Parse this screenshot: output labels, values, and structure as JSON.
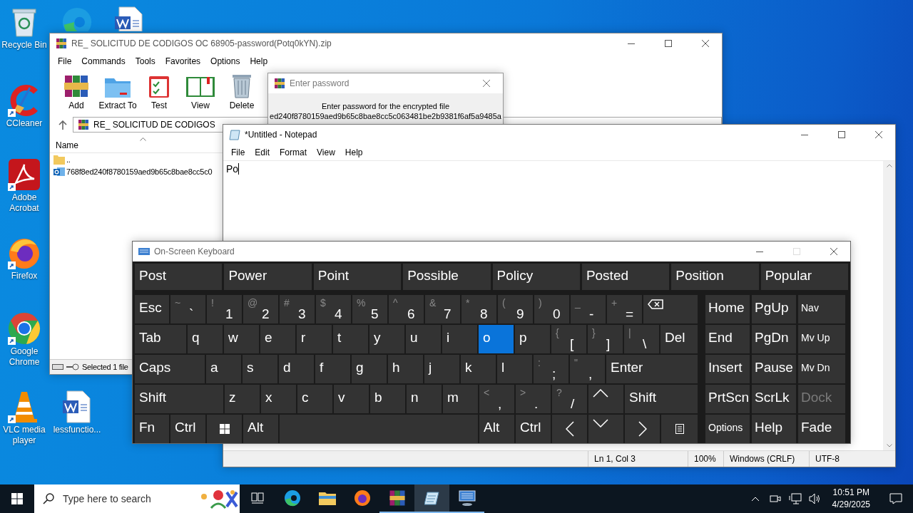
{
  "desktop_icons": [
    {
      "label": "Recycle Bin"
    },
    {
      "label": "CCleaner"
    },
    {
      "label": "Adobe Acrobat"
    },
    {
      "label": "Firefox"
    },
    {
      "label": "Google Chrome"
    },
    {
      "label": "VLC media player"
    },
    {
      "label": "lessfunctio..."
    }
  ],
  "winrar": {
    "title": "RE_ SOLICITUD DE CODIGOS OC 68905-password(Potq0kYN).zip",
    "menu": [
      "File",
      "Commands",
      "Tools",
      "Favorites",
      "Options",
      "Help"
    ],
    "toolbar": [
      "Add",
      "Extract To",
      "Test",
      "View",
      "Delete"
    ],
    "path": "RE_ SOLICITUD DE CODIGOS",
    "columns": [
      "Name"
    ],
    "files": [
      {
        "name": "..",
        "kind": "folder"
      },
      {
        "name": "768f8ed240f8780159aed9b65c8bae8cc5c0",
        "kind": "mail"
      }
    ],
    "status": "Selected 1 file"
  },
  "password_dialog": {
    "title": "Enter password",
    "message": "Enter password for the encrypted file",
    "file_name": "ed240f8780159aed9b65c8bae8cc5c063481be2b9381f6af5a9485a"
  },
  "notepad": {
    "title": "*Untitled - Notepad",
    "menu": [
      "File",
      "Edit",
      "Format",
      "View",
      "Help"
    ],
    "text": "Po",
    "status": [
      "Ln 1, Col 3",
      "100%",
      "Windows (CRLF)",
      "UTF-8"
    ]
  },
  "osk": {
    "title": "On-Screen Keyboard",
    "predictions": [
      "Post",
      "Power",
      "Point",
      "Possible",
      "Policy",
      "Posted",
      "Position",
      "Popular"
    ],
    "rows": [
      {
        "keys": [
          {
            "label": "Esc",
            "kind": "text",
            "selected": false
          },
          {
            "label": "`",
            "shift": "~",
            "kind": "text",
            "selected": false
          },
          {
            "label": "1",
            "shift": "!",
            "kind": "text",
            "selected": false
          },
          {
            "label": "2",
            "shift": "@",
            "kind": "text",
            "selected": false
          },
          {
            "label": "3",
            "shift": "#",
            "kind": "text",
            "selected": false
          },
          {
            "label": "4",
            "shift": "$",
            "kind": "text",
            "selected": false
          },
          {
            "label": "5",
            "shift": "%",
            "kind": "text",
            "selected": false
          },
          {
            "label": "6",
            "shift": "^",
            "kind": "text",
            "selected": false
          },
          {
            "label": "7",
            "shift": "&",
            "kind": "text",
            "selected": false
          },
          {
            "label": "8",
            "shift": "*",
            "kind": "text",
            "selected": false
          },
          {
            "label": "9",
            "shift": "(",
            "kind": "text",
            "selected": false
          },
          {
            "label": "0",
            "shift": ")",
            "kind": "text",
            "selected": false
          },
          {
            "label": "-",
            "shift": "_",
            "kind": "text",
            "selected": false
          },
          {
            "label": "=",
            "shift": "+",
            "kind": "text",
            "selected": false
          },
          {
            "kind": "backspace",
            "selected": false
          }
        ]
      },
      {
        "keys": [
          {
            "label": "Tab",
            "kind": "text",
            "selected": false
          },
          {
            "label": "q",
            "kind": "text",
            "selected": false
          },
          {
            "label": "w",
            "kind": "text",
            "selected": false
          },
          {
            "label": "e",
            "kind": "text",
            "selected": false
          },
          {
            "label": "r",
            "kind": "text",
            "selected": false
          },
          {
            "label": "t",
            "kind": "text",
            "selected": false
          },
          {
            "label": "y",
            "kind": "text",
            "selected": false
          },
          {
            "label": "u",
            "kind": "text",
            "selected": false
          },
          {
            "label": "i",
            "kind": "text",
            "selected": false
          },
          {
            "label": "o",
            "kind": "text",
            "selected": true
          },
          {
            "label": "p",
            "kind": "text",
            "selected": false
          },
          {
            "label": "[",
            "shift": "{",
            "kind": "text",
            "selected": false
          },
          {
            "label": "]",
            "shift": "}",
            "kind": "text",
            "selected": false
          },
          {
            "label": "\\",
            "shift": "|",
            "kind": "text",
            "selected": false
          },
          {
            "label": "Del",
            "kind": "text",
            "selected": false
          }
        ]
      },
      {
        "keys": [
          {
            "label": "Caps",
            "kind": "text",
            "selected": false
          },
          {
            "label": "a",
            "kind": "text",
            "selected": false
          },
          {
            "label": "s",
            "kind": "text",
            "selected": false
          },
          {
            "label": "d",
            "kind": "text",
            "selected": false
          },
          {
            "label": "f",
            "kind": "text",
            "selected": false
          },
          {
            "label": "g",
            "kind": "text",
            "selected": false
          },
          {
            "label": "h",
            "kind": "text",
            "selected": false
          },
          {
            "label": "j",
            "kind": "text",
            "selected": false
          },
          {
            "label": "k",
            "kind": "text",
            "selected": false
          },
          {
            "label": "l",
            "kind": "text",
            "selected": false
          },
          {
            "label": ";",
            "shift": ":",
            "kind": "text",
            "selected": false
          },
          {
            "label": ",",
            "shift": "\"",
            "kind": "text",
            "selected": false
          },
          {
            "label": "Enter",
            "kind": "text",
            "selected": false
          }
        ]
      },
      {
        "keys": [
          {
            "label": "Shift",
            "kind": "text",
            "selected": false
          },
          {
            "label": "z",
            "kind": "text",
            "selected": false
          },
          {
            "label": "x",
            "kind": "text",
            "selected": false
          },
          {
            "label": "c",
            "kind": "text",
            "selected": false
          },
          {
            "label": "v",
            "kind": "text",
            "selected": false
          },
          {
            "label": "b",
            "kind": "text",
            "selected": false
          },
          {
            "label": "n",
            "kind": "text",
            "selected": false
          },
          {
            "label": "m",
            "kind": "text",
            "selected": false
          },
          {
            "label": ",",
            "shift": "<",
            "kind": "text",
            "selected": false
          },
          {
            "label": ".",
            "shift": ">",
            "kind": "text",
            "selected": false
          },
          {
            "label": "/",
            "shift": "?",
            "kind": "text",
            "selected": false
          },
          {
            "kind": "up",
            "selected": false
          },
          {
            "label": "Shift",
            "kind": "text",
            "selected": false
          }
        ]
      },
      {
        "keys": [
          {
            "label": "Fn",
            "kind": "text",
            "selected": false
          },
          {
            "label": "Ctrl",
            "kind": "text",
            "selected": false
          },
          {
            "kind": "windows",
            "selected": false
          },
          {
            "label": "Alt",
            "kind": "text",
            "selected": false
          },
          {
            "kind": "space",
            "selected": false
          },
          {
            "label": "Alt",
            "kind": "text",
            "selected": false
          },
          {
            "label": "Ctrl",
            "kind": "text",
            "selected": false
          },
          {
            "kind": "left",
            "selected": false
          },
          {
            "kind": "down",
            "selected": false
          },
          {
            "kind": "right",
            "selected": false
          },
          {
            "kind": "menu",
            "selected": false
          }
        ]
      }
    ],
    "nav_keys": [
      {
        "label": "Home",
        "disabled": false
      },
      {
        "label": "PgUp",
        "disabled": false
      },
      {
        "label": "Nav",
        "disabled": false
      },
      {
        "label": "End",
        "disabled": false
      },
      {
        "label": "PgDn",
        "disabled": false
      },
      {
        "label": "Mv Up",
        "disabled": false
      },
      {
        "label": "Insert",
        "disabled": false
      },
      {
        "label": "Pause",
        "disabled": false
      },
      {
        "label": "Mv Dn",
        "disabled": false
      },
      {
        "label": "PrtScn",
        "disabled": false
      },
      {
        "label": "ScrLk",
        "disabled": false
      },
      {
        "label": "Dock",
        "disabled": true
      },
      {
        "label": "Options",
        "disabled": false
      },
      {
        "label": "Help",
        "disabled": false
      },
      {
        "label": "Fade",
        "disabled": false
      }
    ]
  },
  "taskbar": {
    "search": {
      "placeholder": "Type here to search"
    },
    "apps": [
      {
        "kind": "taskview",
        "running": false,
        "selected": false
      },
      {
        "kind": "edge",
        "running": false,
        "selected": false
      },
      {
        "kind": "explorer",
        "running": false,
        "selected": false
      },
      {
        "kind": "firefox",
        "running": false,
        "selected": false
      },
      {
        "kind": "winrar",
        "running": true,
        "selected": false
      },
      {
        "kind": "notepad",
        "running": true,
        "selected": true
      },
      {
        "kind": "keyboard",
        "running": true,
        "selected": false
      }
    ],
    "clock": {
      "time": "10:51 PM",
      "date": "4/29/2025"
    }
  }
}
